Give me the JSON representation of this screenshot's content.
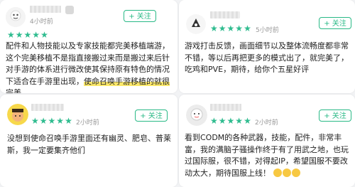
{
  "reviews": [
    {
      "time": "4小时前",
      "follow": "+ 关注",
      "rating": 5,
      "text": "配件和人物技能以及专家技能都完美移植端游，这个完美移植不是指直接搬过来而是搬过来后针对手游的体系进行微改使其保持原有特色的情况下适合在手游里出现，使命召唤手游移植的就很完美。",
      "highlight": "使命召唤手游移植的就很完美。"
    },
    {
      "time": "5小时前",
      "follow": "+ 关注",
      "rating": 5,
      "text": "游戏打击反馈，画面细节以及整体流畅度都非常不错，等以后再把更多的模式出了，就完美了，吃鸡和PVE，期待，给你个五星好评"
    },
    {
      "time": "2小时前",
      "follow": "+ 关注",
      "rating": 5,
      "text": "没想到使命召唤手游里面还有幽灵、肥皂、普莱斯，我一定要集齐他们"
    },
    {
      "time": "2小时前",
      "follow": "+ 关注",
      "rating": 5,
      "text": "看到CODM的各种武器，技能，配件，非常丰富，我的满脑子骚操作终于有了用武之地，也玩过国际服，很不错，对得起IP，希望国服不要改动太大，期待国服上线！"
    }
  ],
  "star_glyph": "★",
  "colors": {
    "accent": "#29b986",
    "star": "#2fbc8f",
    "highlight": "#fbe86a"
  }
}
